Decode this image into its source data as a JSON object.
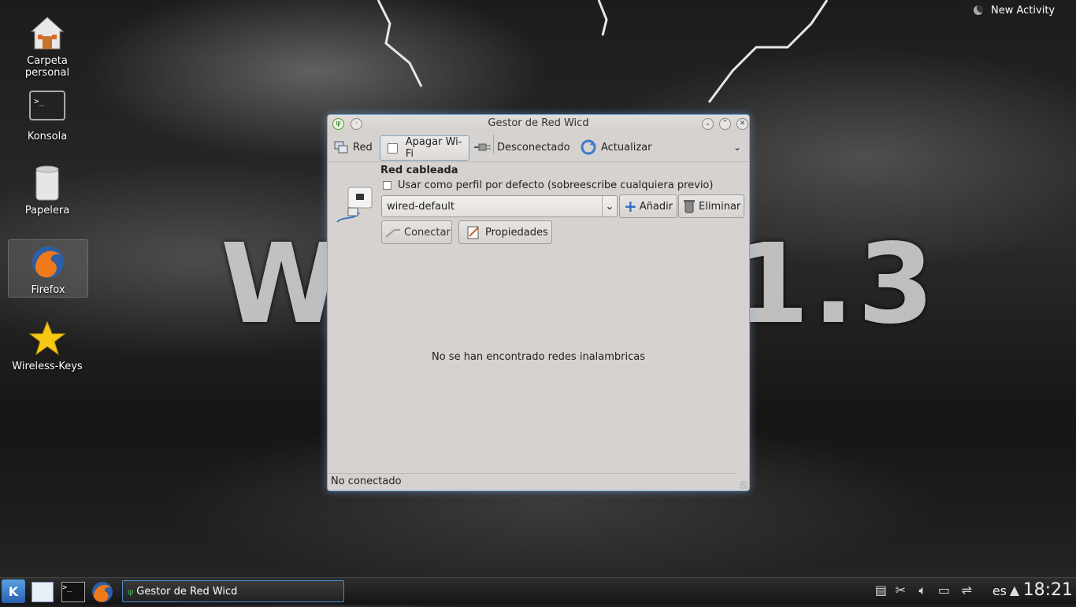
{
  "desktop": {
    "icons": [
      {
        "label": "Carpeta\npersonal"
      },
      {
        "label": "Konsola"
      },
      {
        "label": "Papelera"
      },
      {
        "label": "Firefox"
      },
      {
        "label": "Wireless-Keys"
      }
    ],
    "new_activity": "New Activity",
    "wallpaper_text_left": "W",
    "wallpaper_text_right": "1.3"
  },
  "window": {
    "title": "Gestor de Red Wicd",
    "toolbar": {
      "network": "Red",
      "wifi_off": "Apagar Wi-Fi",
      "status": "Desconectado",
      "refresh": "Actualizar"
    },
    "wired": {
      "heading": "Red cableada",
      "default_profile": "Usar como perfil por defecto (sobreescribe cualquiera previo)",
      "profile_value": "wired-default",
      "add": "Añadir",
      "remove": "Eliminar",
      "connect": "Conectar",
      "properties": "Propiedades"
    },
    "empty_message": "No se han encontrado redes inalambricas",
    "statusbar": "No conectado"
  },
  "taskbar": {
    "task_title": "Gestor de Red Wicd",
    "language": "es",
    "clock": "18:21"
  },
  "colors": {
    "accent": "#4a8cc8",
    "window_bg": "#d6d2d0"
  }
}
